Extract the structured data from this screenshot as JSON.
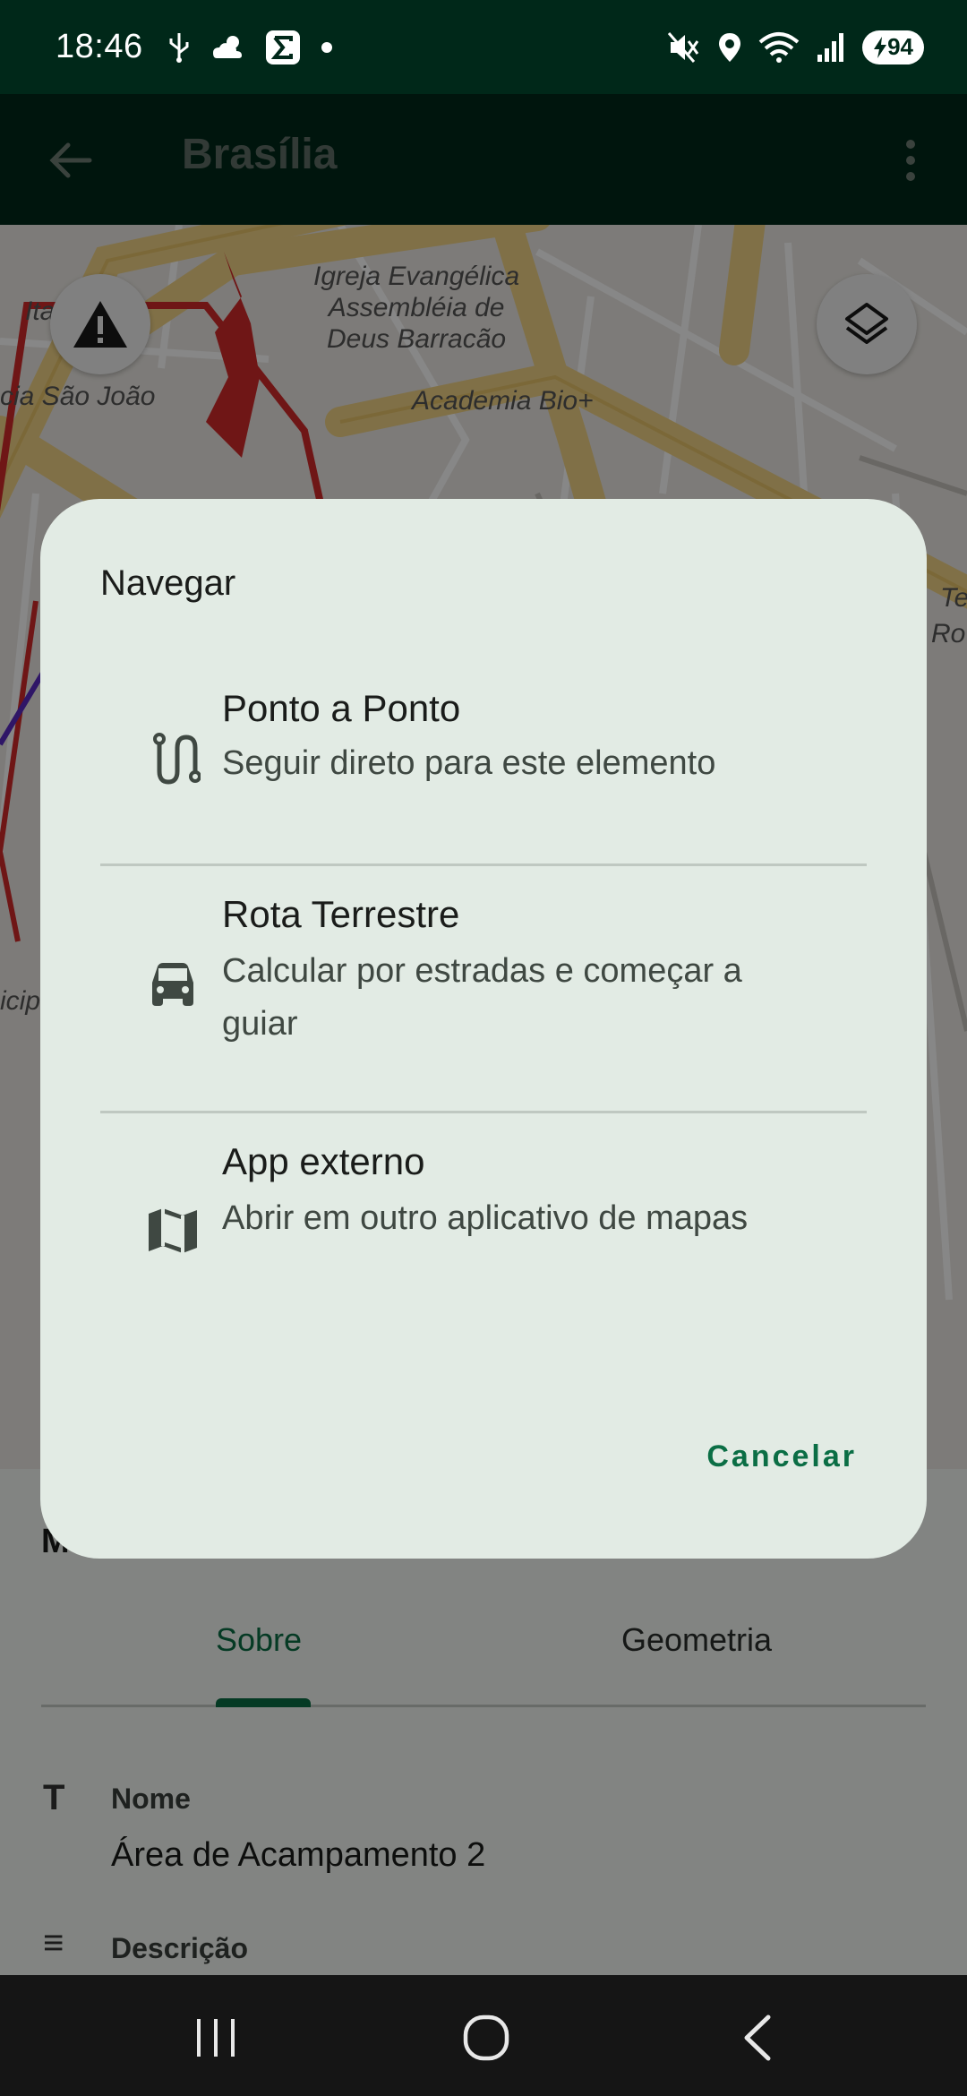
{
  "status_bar": {
    "time": "18:46",
    "battery": "94",
    "left_icons": [
      "usb-icon",
      "weather-icon",
      "sigma-app-icon",
      "dot-icon"
    ],
    "right_icons": [
      "mute-icon",
      "location-icon",
      "wifi-icon",
      "signal-icon"
    ]
  },
  "app_bar": {
    "title": "Brasília"
  },
  "map": {
    "labels": {
      "church": "Igreja Evangélica\nAssembléia de\nDeus Barracão",
      "gym": "Academia Bio+",
      "school": "cia São João",
      "ita": "Ita",
      "te": "Te",
      "ro": "Ro",
      "cip": "icip"
    }
  },
  "sheet": {
    "title_partial": "M",
    "tabs": [
      "Sobre",
      "Geometria"
    ],
    "fields": [
      {
        "icon": "T",
        "label": "Nome",
        "value": "Área de Acampamento 2"
      },
      {
        "icon": "≡",
        "label": "Descrição"
      }
    ]
  },
  "dialog": {
    "title": "Navegar",
    "options": [
      {
        "title": "Ponto a Ponto",
        "description": "Seguir direto para este elemento",
        "icon": "route-icon"
      },
      {
        "title": "Rota Terrestre",
        "description": "Calcular por estradas e começar a guiar",
        "icon": "car-icon"
      },
      {
        "title": "App externo",
        "description": "Abrir em outro aplicativo de mapas",
        "icon": "map-icon"
      }
    ],
    "cancel_label": "Cancelar"
  },
  "colors": {
    "app_bar": "#002819",
    "accent": "#0b6e45",
    "dialog_bg": "#e2ebe4"
  }
}
